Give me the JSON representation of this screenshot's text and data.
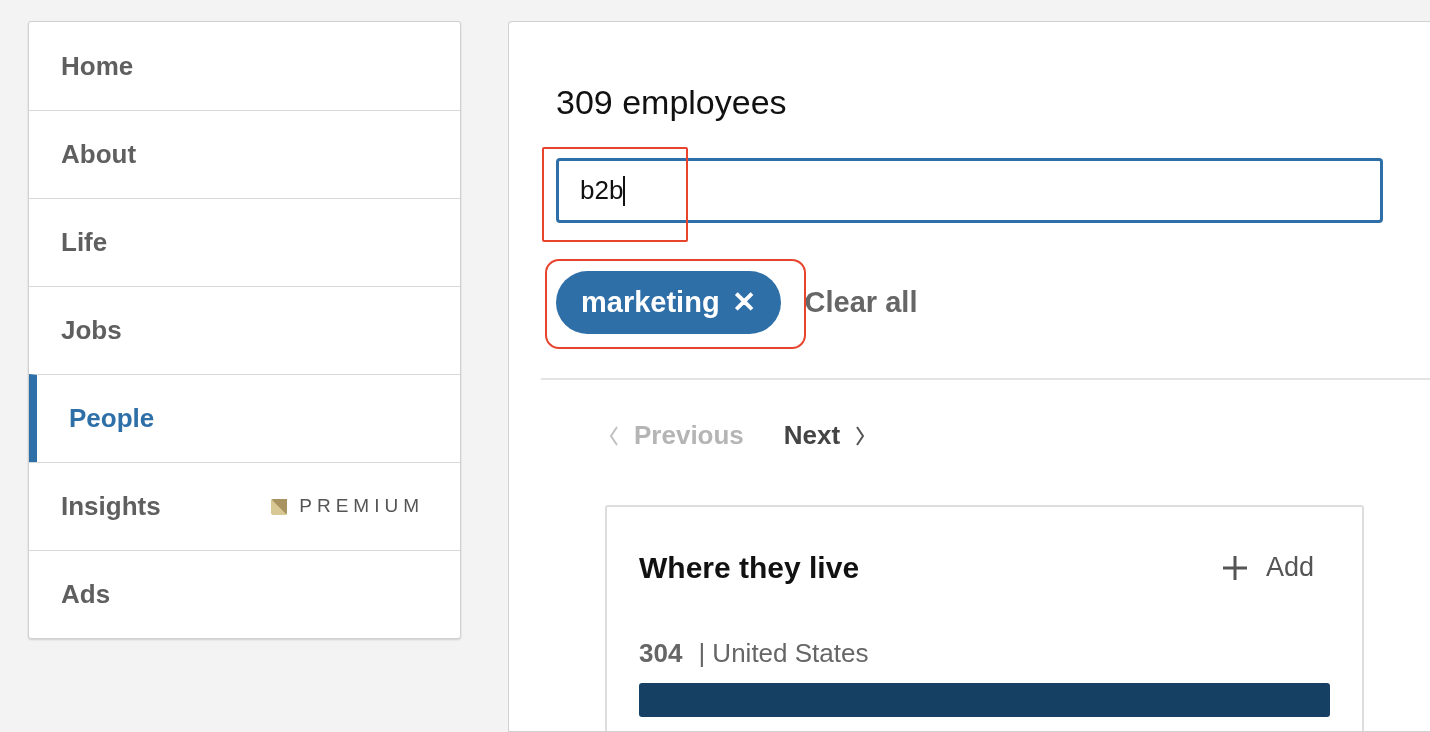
{
  "sidebar": {
    "items": [
      {
        "label": "Home",
        "selected": false
      },
      {
        "label": "About",
        "selected": false
      },
      {
        "label": "Life",
        "selected": false
      },
      {
        "label": "Jobs",
        "selected": false
      },
      {
        "label": "People",
        "selected": true
      },
      {
        "label": "Insights",
        "selected": false,
        "badge": "PREMIUM"
      },
      {
        "label": "Ads",
        "selected": false
      }
    ]
  },
  "main": {
    "title": "309 employees",
    "search": {
      "value": "b2b"
    },
    "filters": [
      {
        "label": "marketing",
        "remove": "✕"
      }
    ],
    "clear_all": "Clear all",
    "pagination": {
      "previous": {
        "label": "Previous",
        "disabled": true
      },
      "next": {
        "label": "Next",
        "disabled": false
      }
    },
    "card": {
      "title": "Where they live",
      "add": "Add",
      "rows": [
        {
          "count": "304",
          "label": "| United States"
        }
      ]
    }
  }
}
